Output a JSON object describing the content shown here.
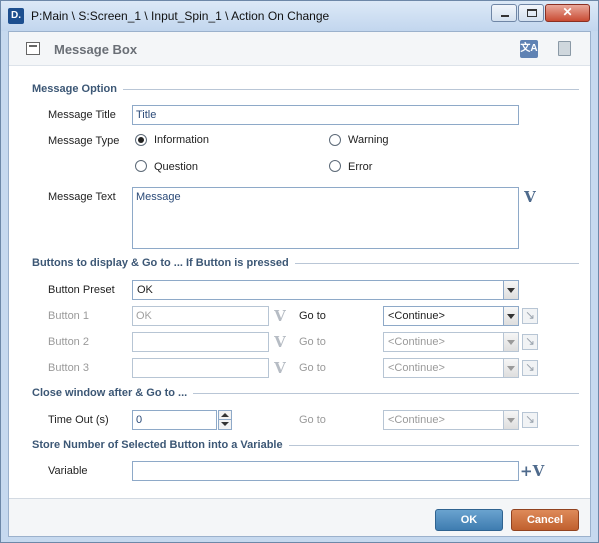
{
  "window": {
    "app_icon_text": "D.",
    "title": "P:Main \\ S:Screen_1 \\ Input_Spin_1 \\ Action On Change",
    "close_glyph": "✕"
  },
  "header": {
    "title": "Message Box",
    "translate_icon_text": "文A"
  },
  "message_option": {
    "section_title": "Message Option",
    "title_label": "Message Title",
    "title_value": "Title",
    "type_label": "Message Type",
    "types": {
      "information": "Information",
      "warning": "Warning",
      "question": "Question",
      "error": "Error"
    },
    "selected_type": "Information",
    "text_label": "Message Text",
    "text_value": "Message"
  },
  "buttons_section": {
    "section_title": "Buttons to display & Go to ... If Button is pressed",
    "preset_label": "Button Preset",
    "preset_value": "OK",
    "goto_label": "Go to",
    "rows": [
      {
        "label": "Button 1",
        "value": "OK",
        "goto": "<Continue>"
      },
      {
        "label": "Button 2",
        "value": "",
        "goto": "<Continue>"
      },
      {
        "label": "Button 3",
        "value": "",
        "goto": "<Continue>"
      }
    ]
  },
  "close_section": {
    "section_title": "Close window after & Go to ...",
    "timeout_label": "Time Out (s)",
    "timeout_value": "0",
    "goto_label": "Go to",
    "goto_value": "<Continue>"
  },
  "store_section": {
    "section_title": "Store Number of Selected Button into a Variable",
    "variable_label": "Variable",
    "variable_value": "",
    "variable_button_glyph": "+V"
  },
  "var_glyph": "V",
  "footer": {
    "ok_label": "OK",
    "cancel_label": "Cancel"
  },
  "colors": {
    "ok_button": "#3e7cb0",
    "cancel_button": "#c0602e",
    "section_title": "#3c5775"
  }
}
